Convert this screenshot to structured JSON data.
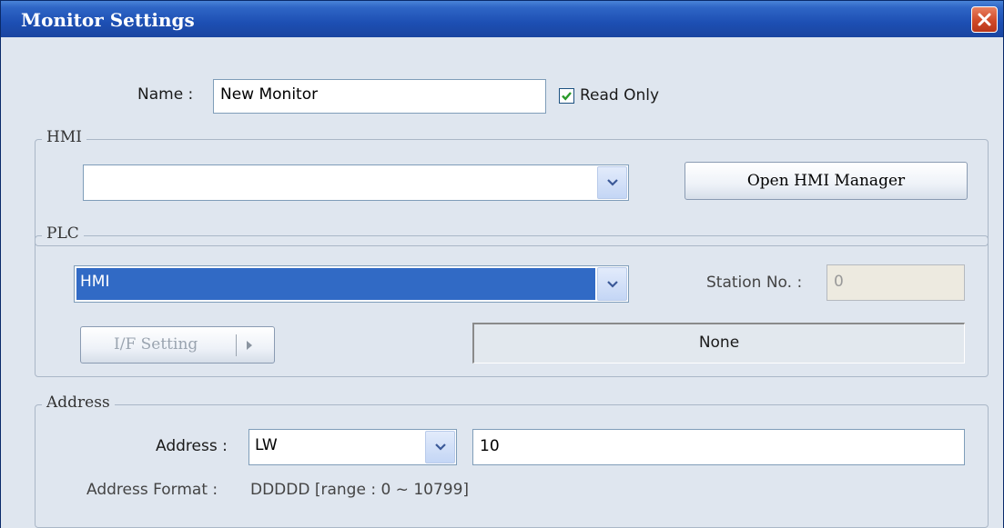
{
  "window": {
    "title": "Monitor Settings"
  },
  "name_row": {
    "label": "Name :",
    "value": "New Monitor",
    "read_only_label": "Read Only",
    "read_only_checked": true
  },
  "hmi": {
    "legend": "HMI",
    "selected": "",
    "open_manager_label": "Open HMI Manager"
  },
  "plc": {
    "legend": "PLC",
    "selected": "HMI",
    "station_label": "Station No. :",
    "station_value": "0",
    "if_setting_label": "I/F Setting",
    "interface_value": "None"
  },
  "address": {
    "legend": "Address",
    "label": "Address :",
    "type_selected": "LW",
    "value": "10",
    "format_label": "Address Format :",
    "format_value": "DDDDD [range : 0 ~ 10799]"
  },
  "icons": {
    "close": "close-icon",
    "check": "check-icon",
    "dropdown": "chevron-down-icon",
    "arrow": "play-arrow-icon"
  },
  "colors": {
    "titlebar": "#1d4fb3",
    "selection": "#316ac5",
    "close": "#d04a28",
    "check": "#2a9a2a"
  }
}
